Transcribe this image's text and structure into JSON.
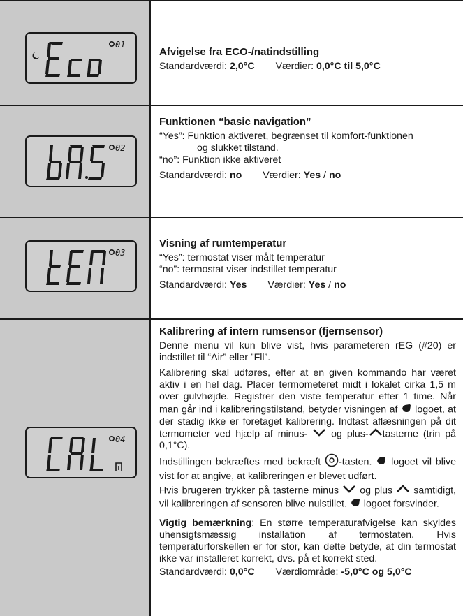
{
  "rows": [
    {
      "display": {
        "code": "Eco",
        "index": "01"
      },
      "title": "Afvigelse fra ECO-/natindstilling",
      "standard_label": "Standardværdi: ",
      "standard_value": "2,0°C",
      "values_label": "Værdier: ",
      "values_value": "0,0°C til 5,0°C"
    },
    {
      "display": {
        "code": "bAS",
        "index": "02"
      },
      "title": "Funktionen “basic navigation”",
      "yes_key": "“Yes”",
      "yes_text": ": Funktion aktiveret, begrænset til komfort-funktionen",
      "yes_text_cont": "og slukket tilstand.",
      "no_key": "“no”",
      "no_text": ": Funktion ikke aktiveret",
      "standard_label": "Standardværdi: ",
      "standard_value": "no",
      "values_label": "Værdier: ",
      "values_value_a": "Yes",
      "values_sep": " / ",
      "values_value_b": "no"
    },
    {
      "display": {
        "code": "tEn",
        "index": "03"
      },
      "title": "Visning af rumtemperatur",
      "yes_key": "“Yes”",
      "yes_text": ": termostat viser målt temperatur",
      "no_key": "“no”",
      "no_text": ":   termostat viser indstillet temperatur",
      "standard_label": "Standardværdi: ",
      "standard_value": "Yes",
      "values_label": "Værdier: ",
      "values_value_a": "Yes",
      "values_sep": " / ",
      "values_value_b": "no"
    },
    {
      "display": {
        "code": "CAL",
        "index": "04"
      },
      "title": "Kalibrering af intern rumsensor (fjernsensor)",
      "p1": "Denne menu vil kun blive vist, hvis parameteren rEG (#20) er indstillet til “Air” eller ”Fll”.",
      "p2a": "Kalibrering skal udføres, efter at en given kommando har været aktiv i en hel dag. Placer termometeret midt i lokalet cirka 1,5 m over gulvhøjde. Registrer den viste temperatur efter 1 time. Når man går ind i kalibreringstilstand, betyder visningen af ",
      "p2b": " logoet, at der stadig ikke er foretaget kalibrering. Indtast aflæsningen på dit termometer ved hjælp af minus- ",
      "p2c": " og plus-",
      "p2d": "tasterne (trin på 0,1°C).",
      "p3a": "Indstillingen bekræftes med bekræft ",
      "p3b": "-tasten. ",
      "p3c": " logoet vil blive vist for at angive, at kalibreringen er blevet udført.",
      "p4a": "Hvis brugeren trykker på tasterne minus ",
      "p4b": " og plus ",
      "p4c": " samtidigt, vil kalibreringen af sensoren blive nulstillet. ",
      "p4d": " logoet forsvinder.",
      "note_label": "Vigtig bemærkning",
      "note_text": ": En større temperaturafvigelse kan skyldes uhensigtsmæssig installation af termostaten. Hvis temperaturforskellen er for stor, kan dette betyde, at din termostat ikke var installeret korrekt, dvs. på et korrekt sted.",
      "standard_label": "Standardværdi: ",
      "standard_value": "0,0°C",
      "values_label": "Værdiområde: ",
      "values_value": "-5,0°C og 5,0°C"
    }
  ],
  "icons": {
    "hand": "hand-icon",
    "minus": "chevron-down-icon",
    "plus": "chevron-up-icon",
    "confirm": "confirm-circle-icon",
    "gear": "gear-icon",
    "moon": "moon-icon",
    "thermometer": "thermometer-icon"
  },
  "colors": {
    "panel": "#c9c9c9",
    "lcd": "#cfcfcf",
    "ink": "#1a1a1a"
  }
}
